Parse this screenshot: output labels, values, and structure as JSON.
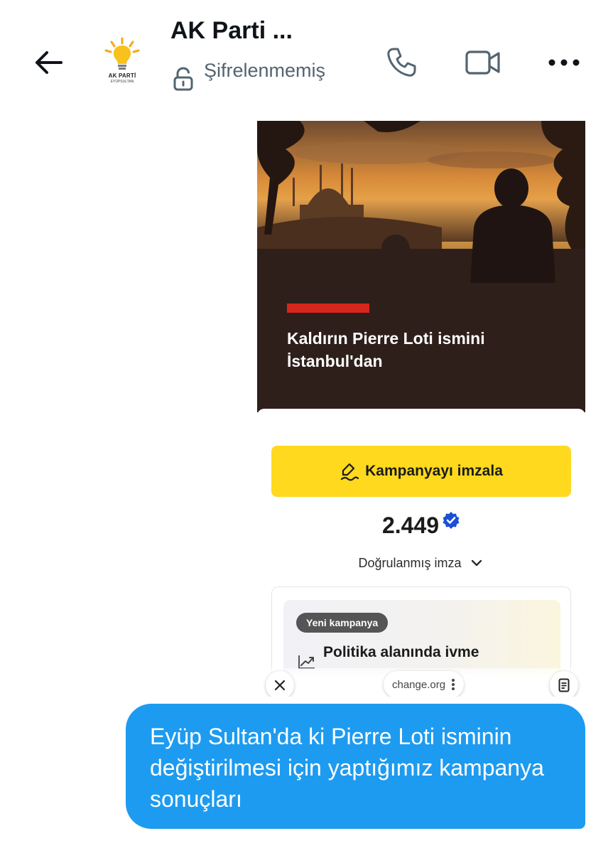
{
  "header": {
    "title": "AK Parti ...",
    "encryption_status": "Şifrelenmemiş",
    "avatar": {
      "party_name": "AK PARTİ",
      "district": "EYÜPSULTAN"
    }
  },
  "link_card": {
    "headline": "Kaldırın Pierre Loti ismini İstanbul'dan",
    "sign_button_label": "Kampanyayı imzala",
    "signature_count": "2.449",
    "verified_label": "Doğrulanmış imza",
    "inner_card": {
      "badge": "Yeni kampanya",
      "title": "Politika alanında ivme"
    },
    "domain": "change.org"
  },
  "message": {
    "text": "Eyüp Sultan'da ki Pierre Loti isminin değiştirilmesi için yaptığımız kampanya sonuçları"
  },
  "colors": {
    "bubble": "#1d9bf0",
    "sign_button": "#ffd91e",
    "accent_bar": "#d7261e",
    "verified": "#1a4fd6",
    "secondary_text": "#536471"
  }
}
